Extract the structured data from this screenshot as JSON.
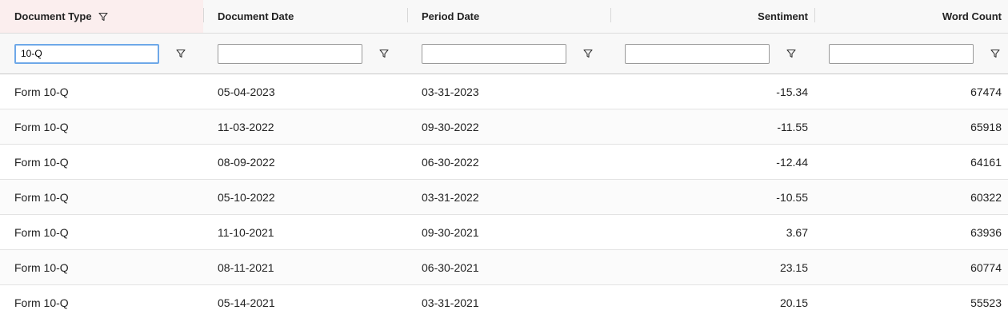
{
  "columns": [
    {
      "label": "Document Type",
      "filter_value": "10-Q",
      "filtered": true
    },
    {
      "label": "Document Date",
      "filter_value": ""
    },
    {
      "label": "Period Date",
      "filter_value": ""
    },
    {
      "label": "Sentiment",
      "filter_value": ""
    },
    {
      "label": "Word Count",
      "filter_value": ""
    }
  ],
  "rows": [
    [
      "Form 10-Q",
      "05-04-2023",
      "03-31-2023",
      "-15.34",
      "67474"
    ],
    [
      "Form 10-Q",
      "11-03-2022",
      "09-30-2022",
      "-11.55",
      "65918"
    ],
    [
      "Form 10-Q",
      "08-09-2022",
      "06-30-2022",
      "-12.44",
      "64161"
    ],
    [
      "Form 10-Q",
      "05-10-2022",
      "03-31-2022",
      "-10.55",
      "60322"
    ],
    [
      "Form 10-Q",
      "11-10-2021",
      "09-30-2021",
      "3.67",
      "63936"
    ],
    [
      "Form 10-Q",
      "08-11-2021",
      "06-30-2021",
      "23.15",
      "60774"
    ],
    [
      "Form 10-Q",
      "05-14-2021",
      "03-31-2021",
      "20.15",
      "55523"
    ]
  ],
  "icons": {
    "filter": "filter-icon"
  },
  "colors": {
    "filtered_header_bg": "#fbeeee",
    "active_input_border": "#6ea8e8"
  }
}
